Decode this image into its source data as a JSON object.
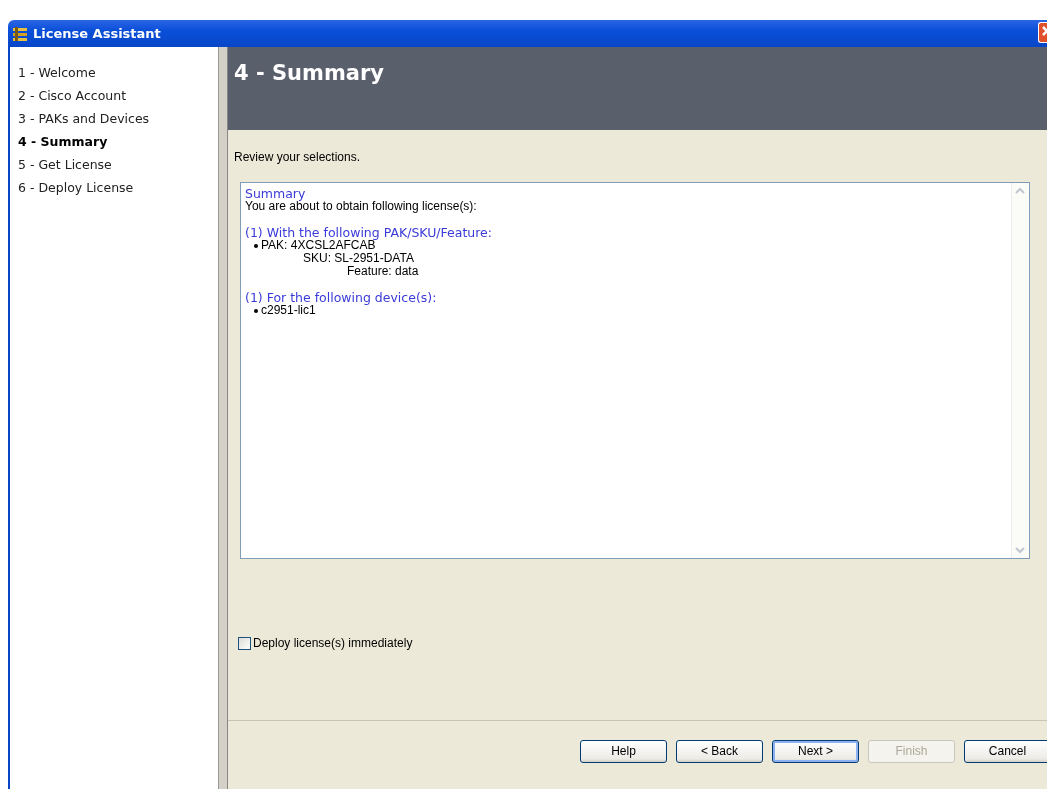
{
  "window": {
    "title": "License Assistant"
  },
  "steps": [
    {
      "label": "1 - Welcome",
      "selected": false
    },
    {
      "label": "2 - Cisco Account",
      "selected": false
    },
    {
      "label": "3 - PAKs and Devices",
      "selected": false
    },
    {
      "label": "4 - Summary",
      "selected": true
    },
    {
      "label": "5 - Get License",
      "selected": false
    },
    {
      "label": "6 - Deploy License",
      "selected": false
    }
  ],
  "header": {
    "title": "4 - Summary"
  },
  "instruction": "Review your selections.",
  "summary": {
    "heading": "Summary",
    "intro": "You are about to obtain following license(s):",
    "sections": [
      {
        "title": "(1) With the following PAK/SKU/Feature:",
        "items": [
          {
            "text": "PAK: 4XCSL2AFCAB",
            "children": [
              {
                "text": "SKU: SL-2951-DATA",
                "children": [
                  {
                    "text": "Feature: data"
                  }
                ]
              }
            ]
          }
        ]
      },
      {
        "title": "(1) For the following device(s):",
        "items": [
          {
            "text": "c2951-lic1"
          }
        ]
      }
    ]
  },
  "deploy_checkbox": {
    "label": "Deploy license(s) immediately",
    "checked": false
  },
  "buttons": [
    {
      "label": "Help",
      "disabled": false,
      "default": false
    },
    {
      "label": "< Back",
      "disabled": false,
      "default": false
    },
    {
      "label": "Next >",
      "disabled": false,
      "default": true
    },
    {
      "label": "Finish",
      "disabled": true,
      "default": false
    },
    {
      "label": "Cancel",
      "disabled": false,
      "default": false
    }
  ]
}
